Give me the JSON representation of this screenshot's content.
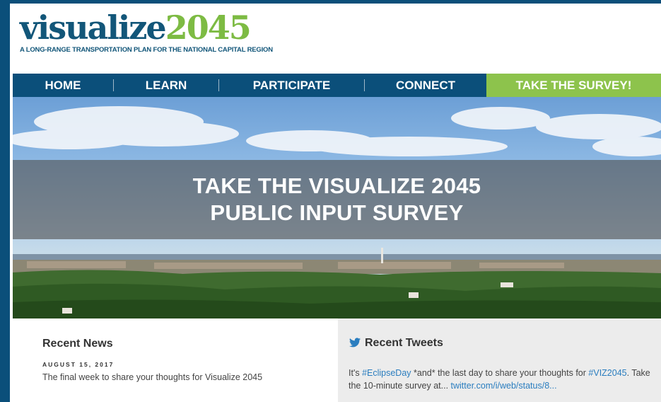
{
  "logo": {
    "word_part1": "visualize",
    "word_part2": "2045",
    "tagline": "A LONG-RANGE TRANSPORTATION PLAN FOR THE NATIONAL CAPITAL REGION"
  },
  "nav": {
    "items": [
      {
        "label": "HOME"
      },
      {
        "label": "LEARN"
      },
      {
        "label": "PARTICIPATE"
      },
      {
        "label": "CONNECT"
      }
    ],
    "cta": "TAKE THE SURVEY!"
  },
  "hero": {
    "line1": "TAKE THE VISUALIZE 2045",
    "line2": "PUBLIC INPUT SURVEY"
  },
  "news": {
    "heading": "Recent News",
    "date": "AUGUST 15, 2017",
    "item": "The final week to share your thoughts for Visualize 2045"
  },
  "tweets": {
    "heading": "Recent Tweets",
    "part1": "It's ",
    "hashtag1": "#EclipseDay",
    "part2": " *and* the last day to share your thoughts for ",
    "hashtag2": "#VIZ2045",
    "part3": ". Take the 10-minute survey at... ",
    "link": "twitter.com/i/web/status/8..."
  },
  "colors": {
    "nav_bg": "#0b4f7a",
    "cta_bg": "#8dc34c",
    "brand_blue": "#125679",
    "brand_green": "#7dbb43",
    "link": "#2a7dbf"
  }
}
